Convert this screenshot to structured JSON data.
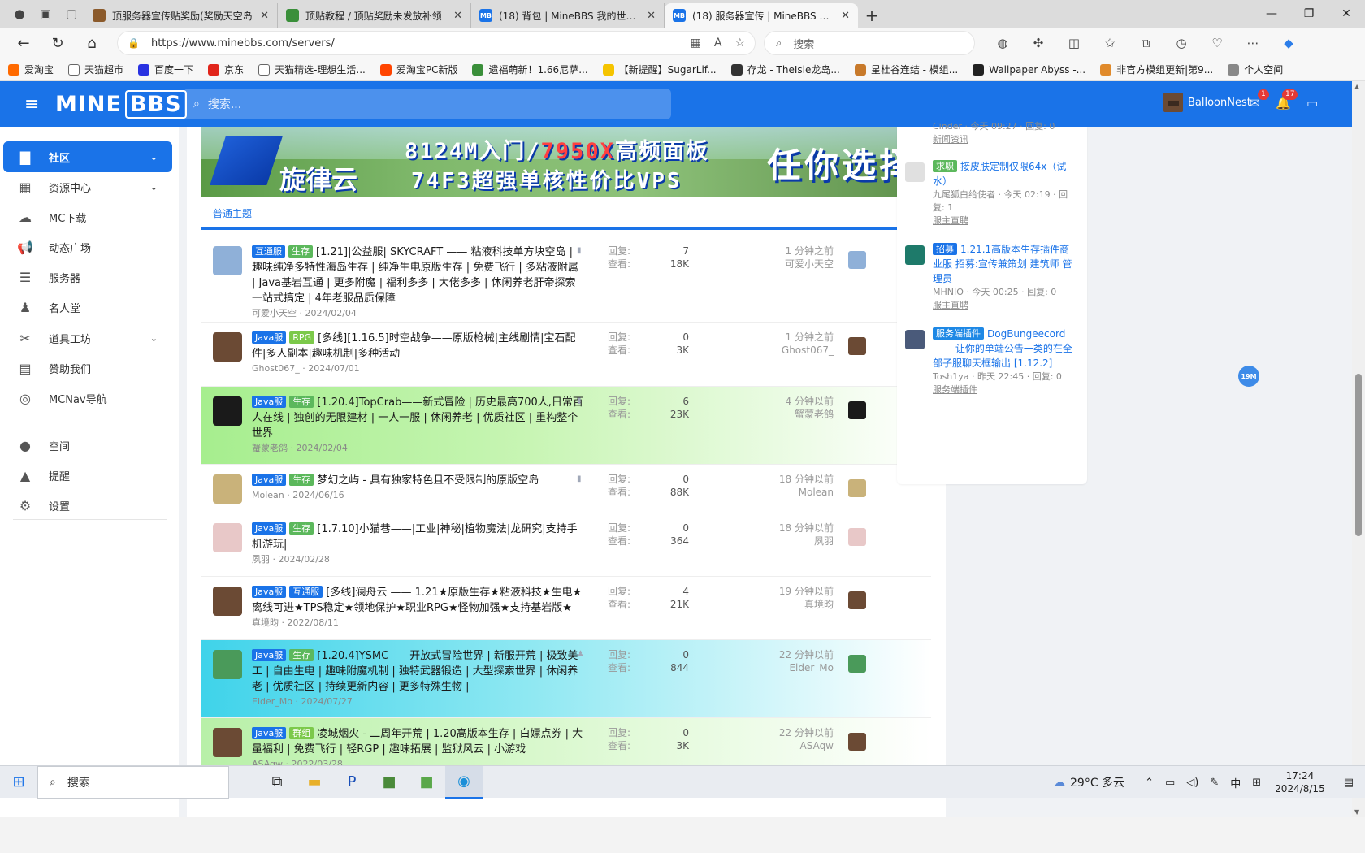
{
  "browser": {
    "tabs": [
      {
        "title": "顶服务器宣传贴奖励(奖励天空岛",
        "color": "#8b5a2b",
        "icon_text": "",
        "active": false
      },
      {
        "title": "顶贴教程 / 顶贴奖励未发放补领",
        "color": "#3a8f3a",
        "icon_text": "",
        "active": false
      },
      {
        "title": "(18) 背包 | MineBBS 我的世界中文",
        "color": "#1a73e8",
        "icon_text": "MB",
        "active": false
      },
      {
        "title": "(18) 服务器宣传 | MineBBS 我的世",
        "color": "#1a73e8",
        "icon_text": "MB",
        "active": true
      }
    ],
    "url": "https://www.minebbs.com/servers/",
    "search_placeholder": "搜索",
    "bookmarks": [
      {
        "label": "爱淘宝",
        "color": "#ff6a00"
      },
      {
        "label": "天猫超市",
        "color": "#ffffff"
      },
      {
        "label": "百度一下",
        "color": "#2932e1"
      },
      {
        "label": "京东",
        "color": "#e1251b"
      },
      {
        "label": "天猫精选-理想生活...",
        "color": "#ffffff"
      },
      {
        "label": "爱淘宝PC新版",
        "color": "#ff4400"
      },
      {
        "label": "遗福萌新！1.66尼萨...",
        "color": "#3a8f3a"
      },
      {
        "label": "【新提醒】SugarLif...",
        "color": "#f5c400"
      },
      {
        "label": "存龙 - TheIsle龙岛...",
        "color": "#333333"
      },
      {
        "label": "星杜谷连结 - 模组...",
        "color": "#c87a2b"
      },
      {
        "label": "Wallpaper Abyss -...",
        "color": "#222222"
      },
      {
        "label": "非官方模组更新|第9...",
        "color": "#e08a2b"
      },
      {
        "label": "个人空间",
        "color": "#888888"
      }
    ]
  },
  "header": {
    "logo_main": "MINE",
    "logo_bbs": "BBS",
    "search_placeholder": "搜索...",
    "username": "BalloonNest",
    "mail_badge": "1",
    "bell_badge": "17"
  },
  "sidebar": {
    "items": [
      {
        "label": "社区",
        "icon": "chat-icon",
        "glyph": "▇",
        "active": true,
        "chevron": true
      },
      {
        "label": "资源中心",
        "icon": "resource-icon",
        "glyph": "▦",
        "active": false,
        "chevron": true
      },
      {
        "label": "MC下载",
        "icon": "cloud-download-icon",
        "glyph": "☁",
        "active": false,
        "chevron": false
      },
      {
        "label": "动态广场",
        "icon": "megaphone-icon",
        "glyph": "📢",
        "active": false,
        "chevron": false
      },
      {
        "label": "服务器",
        "icon": "server-icon",
        "glyph": "☰",
        "active": false,
        "chevron": false
      },
      {
        "label": "名人堂",
        "icon": "user-tie-icon",
        "glyph": "♟",
        "active": false,
        "chevron": false
      },
      {
        "label": "道具工坊",
        "icon": "tools-icon",
        "glyph": "✂",
        "active": false,
        "chevron": true
      },
      {
        "label": "赞助我们",
        "icon": "sponsor-icon",
        "glyph": "▤",
        "active": false,
        "chevron": false
      },
      {
        "label": "MCNav导航",
        "icon": "compass-icon",
        "glyph": "◎",
        "active": false,
        "chevron": false
      },
      {
        "label": "空间",
        "icon": "person-icon",
        "glyph": "●",
        "active": false,
        "chevron": false
      },
      {
        "label": "提醒",
        "icon": "bell-icon",
        "glyph": "▲",
        "active": false,
        "chevron": false
      },
      {
        "label": "设置",
        "icon": "gear-icon",
        "glyph": "⚙",
        "active": false,
        "chevron": false
      }
    ]
  },
  "banner": {
    "line1_a": "8124M入门/",
    "line1_b": "7950X",
    "line1_c": "高频面板",
    "brand": "旋律云",
    "line2": "74F3超强单核性价比VPS",
    "slogan": "任你选择"
  },
  "section_tab": "普通主题",
  "labels": {
    "replies": "回复:",
    "views": "查看:"
  },
  "threads": [
    {
      "prefixes": [
        {
          "text": "互通服",
          "c": "blue"
        },
        {
          "text": "生存",
          "c": "green"
        }
      ],
      "title": "[1.21]|公益服| SKYCRAFT —— 粘液科技单方块空岛 | 趣味纯净多特性海岛生存 | 纯净生电原版生存 | 免费飞行 | 多粘液附属 | Java基岩互通 | 更多附魔 | 福利多多 | 大佬多多 | 休闲养老肝帝探索 一站式搞定 | 4年老服品质保障",
      "author": "可爱小天空",
      "date": "2024/02/04",
      "replies": "7",
      "views": "18K",
      "last_time": "1 分钟之前",
      "last_user": "可爱小天空",
      "avatar": "#8fb0d8",
      "flag": "▮",
      "bg": "#ffffff"
    },
    {
      "prefixes": [
        {
          "text": "Java服",
          "c": "blue"
        },
        {
          "text": "RPG",
          "c": "lime"
        }
      ],
      "title": "[多线][1.16.5]时空战争——原版枪械|主线剧情|宝石配件|多人副本|趣味机制|多种活动",
      "author": "Ghost067_",
      "date": "2024/07/01",
      "replies": "0",
      "views": "3K",
      "last_time": "1 分钟之前",
      "last_user": "Ghost067_",
      "avatar": "#6b4a34",
      "flag": "",
      "bg": "#ffffff"
    },
    {
      "prefixes": [
        {
          "text": "Java服",
          "c": "blue"
        },
        {
          "text": "生存",
          "c": "green"
        }
      ],
      "title": "[1.20.4]TopCrab——新式冒险 | 历史最高700人,日常百人在线 | 独创的无限建材 | 一人一服 | 休闲养老 | 优质社区 | 重构整个世界",
      "author": "蟹蒙老鸽",
      "date": "2024/02/04",
      "replies": "6",
      "views": "23K",
      "last_time": "4 分钟以前",
      "last_user": "蟹蒙老鸽",
      "avatar": "#1a1a1a",
      "flag": "▮",
      "bg": "linear-gradient(90deg, #a6ee8e 0%, #c8f5b4 45%, #ffffff 100%)"
    },
    {
      "prefixes": [
        {
          "text": "Java服",
          "c": "blue"
        },
        {
          "text": "生存",
          "c": "green"
        }
      ],
      "title": "梦幻之屿 - 具有独家特色且不受限制的原版空岛",
      "author": "Molean",
      "date": "2024/06/16",
      "replies": "0",
      "views": "88K",
      "last_time": "18 分钟以前",
      "last_user": "Molean",
      "avatar": "#c9b27a",
      "flag": "▮",
      "bg": "#ffffff"
    },
    {
      "prefixes": [
        {
          "text": "Java服",
          "c": "blue"
        },
        {
          "text": "生存",
          "c": "green"
        }
      ],
      "title": "[1.7.10]小猫巷——|工业|神秘|植物魔法|龙研究|支持手机游玩|",
      "author": "夙羽",
      "date": "2024/02/28",
      "replies": "0",
      "views": "364",
      "last_time": "18 分钟以前",
      "last_user": "夙羽",
      "avatar": "#e8c8c8",
      "flag": "",
      "bg": "#ffffff"
    },
    {
      "prefixes": [
        {
          "text": "Java服",
          "c": "blue"
        },
        {
          "text": "互通服",
          "c": "blue"
        }
      ],
      "title": "[多线]澜舟云 —— 1.21★原版生存★粘液科技★生电★离线可进★TPS稳定★领地保护★职业RPG★怪物加强★支持基岩版★",
      "author": "真境昀",
      "date": "2022/08/11",
      "replies": "4",
      "views": "21K",
      "last_time": "19 分钟以前",
      "last_user": "真境昀",
      "avatar": "#6b4a34",
      "flag": "",
      "bg": "#ffffff"
    },
    {
      "prefixes": [
        {
          "text": "Java服",
          "c": "blue"
        },
        {
          "text": "生存",
          "c": "green"
        }
      ],
      "title": "[1.20.4]YSMC——开放式冒险世界 | 新服开荒 | 极致美工 | 自由生电 | 趣味附魔机制 | 独特武器锻造 | 大型探索世界 | 休闲养老 | 优质社区 | 持续更新内容 | 更多特殊生物 |",
      "author": "Elder_Mo",
      "date": "2024/07/27",
      "replies": "0",
      "views": "844",
      "last_time": "22 分钟以前",
      "last_user": "Elder_Mo",
      "avatar": "#4a9a5a",
      "flag": "♟",
      "bg": "linear-gradient(90deg, #3fd3ea 0%, #8fe8f2 45%, #ffffff 100%)"
    },
    {
      "prefixes": [
        {
          "text": "Java服",
          "c": "blue"
        },
        {
          "text": "群组",
          "c": "lime"
        }
      ],
      "title": "凌城烟火 - 二周年开荒 | 1.20高版本生存 | 白嫖点券 | 大量福利 | 免费飞行 | 轻RGP | 趣味拓展 | 监狱风云 | 小游戏",
      "author": "ASAqw",
      "date": "2022/03/28",
      "replies": "0",
      "views": "3K",
      "last_time": "22 分钟以前",
      "last_user": "ASAqw",
      "avatar": "#6b4a34",
      "flag": "",
      "bg": "linear-gradient(90deg, #b8f0a8 0%, #d8f8cc 45%, #ffffff 100%)"
    }
  ],
  "right_panel": {
    "top_cut_meta": "Cinder · 今天 09:27 · 回复: 0",
    "top_cut_cat": "新闻资讯",
    "items": [
      {
        "prefix": "求职",
        "prefix_color": "#5cb85c",
        "title": "接皮肤定制仅限64x（试水）",
        "meta": "九尾狐白给使者 · 今天 02:19 · 回复: 1",
        "cat": "服主直聘",
        "avatar": "#e0e0e0"
      },
      {
        "prefix": "招募",
        "prefix_color": "#1a73e8",
        "title": "1.21.1高版本生存插件商业服 招募:宣传兼策划 建筑师 管理员",
        "meta": "MHNIO · 今天 00:25 · 回复: 0",
        "cat": "服主直聘",
        "avatar": "#1e7a6a"
      },
      {
        "prefix": "服务端插件",
        "prefix_color": "#1e88e5",
        "title": "DogBungeecord —— 让你的单端公告一类的在全部子服聊天框输出 [1.12.2]",
        "meta": "Tosh1ya · 昨天 22:45 · 回复: 0",
        "cat": "服务端插件",
        "avatar": "#4a5a7a"
      }
    ]
  },
  "float_btn": "19M",
  "taskbar": {
    "search": "搜索",
    "weather": "29°C 多云",
    "time": "17:24",
    "date": "2024/8/15",
    "ime": "中"
  }
}
